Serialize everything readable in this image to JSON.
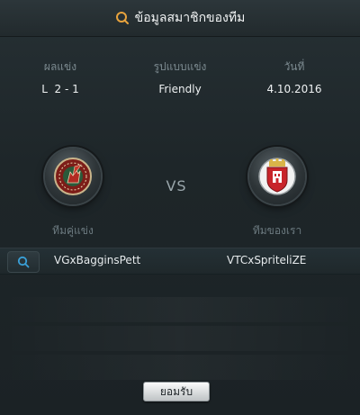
{
  "header": {
    "title": "ข้อมูลสมาชิกของทีม",
    "icon": "search-icon"
  },
  "match_info": {
    "headers": {
      "result": "ผลแข่ง",
      "format": "รูปแบบแข่ง",
      "date": "วันที่"
    },
    "values": {
      "result": "L  2 - 1",
      "format": "Friendly",
      "date": "4.10.2016"
    }
  },
  "teams": {
    "opponent": {
      "label": "ทีมคู่แข่ง",
      "name": "VGxBagginsPett",
      "crest_icon": "griffin-crest-icon"
    },
    "vs": "VS",
    "ours": {
      "label": "ทีมของเรา",
      "name": "VTCxSpriteliZE",
      "crest_icon": "castle-shield-crest-icon"
    }
  },
  "actions": {
    "search_icon": "search-icon",
    "confirm_label": "ยอมรับ"
  },
  "colors": {
    "accent": "#e8a33d",
    "background": "#1e2629",
    "search_icon": "#3aa0d8"
  }
}
